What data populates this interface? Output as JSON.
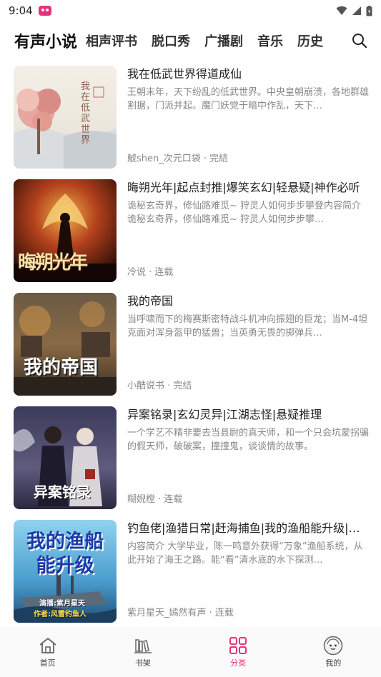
{
  "status": {
    "time": "9:04"
  },
  "tabs": [
    {
      "label": "有声小说",
      "active": true
    },
    {
      "label": "相声评书",
      "active": false
    },
    {
      "label": "脱口秀",
      "active": false
    },
    {
      "label": "广播剧",
      "active": false
    },
    {
      "label": "音乐",
      "active": false
    },
    {
      "label": "历史",
      "active": false
    }
  ],
  "books": [
    {
      "title": "我在低武世界得道成仙",
      "description": "王朝末年，天下纷乱的低武世界。中央皇朝崩溃，各地群雄割据，门派并起。魔门妖党于暗中作乱，天下…",
      "meta": "鯱shen_次元口袋 · 完結",
      "cover_text": "我在低武世界"
    },
    {
      "title": "晦朔光年|起点封推|爆笑玄幻|轻悬疑|神作必听",
      "description": "诡秘玄奇界，修仙路难觅~ 狩灵人如何步步攀登内容简介 诡秘玄奇界，修仙路难觅~ 狩灵人如何步步攀…",
      "meta": "冷说 · 连载",
      "cover_text": "晦朔光年"
    },
    {
      "title": "我的帝国",
      "description": "当呼啸而下的梅赛斯密特战斗机冲向振翅的巨龙；当M-4坦克面对浑身盔甲的猛兽；当英勇无畏的掷弹兵…",
      "meta": "小酷说书 · 完结",
      "cover_text": "我的帝国"
    },
    {
      "title": "异案铭录|玄幻灵异|江湖志怪|悬疑推理",
      "description": "一个学艺不精非要去当县尉的真天师，和一个只会坑蒙拐骗的假天师，破破案，撞撞鬼，谈谈情的故事。",
      "meta": "糊婗樘 · 连载",
      "cover_text": "异案铭录"
    },
    {
      "title": "钓鱼佬|渔猎日常|赶海捕鱼|我的渔船能升级|…",
      "description": "内容简介 大学毕业，陈一鸣意外获得“万象”渔船系统，从此开始了海王之路。能“看”清水底的水下探测…",
      "meta": "紫月星天_嫣然有声 · 连载",
      "cover_text": "我的渔船能升级",
      "cover_sub1": "演播:紫月星天",
      "cover_sub2": "作者:风雪钓鱼人"
    }
  ],
  "bottom_nav": [
    {
      "label": "首页",
      "icon": "home-icon"
    },
    {
      "label": "书架",
      "icon": "bookshelf-icon"
    },
    {
      "label": "分类",
      "icon": "category-grid-icon",
      "active": true
    },
    {
      "label": "我的",
      "icon": "profile-avatar-icon"
    }
  ],
  "colors": {
    "accent": "#e8317a"
  }
}
